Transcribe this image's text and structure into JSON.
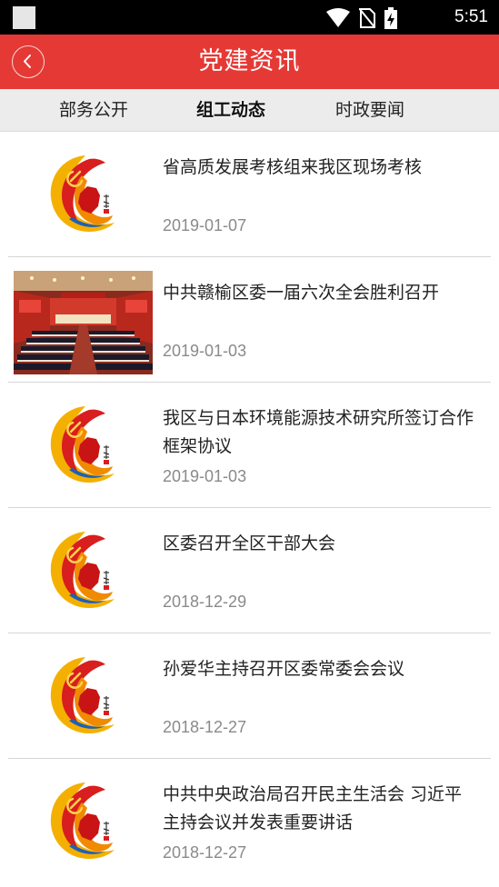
{
  "status_bar": {
    "time": "5:51"
  },
  "header": {
    "title": "党建资讯",
    "back_icon": "chevron-left-icon"
  },
  "tabs": [
    {
      "label": "部务公开",
      "active": false
    },
    {
      "label": "组工动态",
      "active": true
    },
    {
      "label": "时政要闻",
      "active": false
    }
  ],
  "news": [
    {
      "title": "省高质发展考核组来我区现场考核",
      "date": "2019-01-07",
      "thumb": "party-logo"
    },
    {
      "title": "中共赣榆区委一届六次全会胜利召开",
      "date": "2019-01-03",
      "thumb": "conference-photo"
    },
    {
      "title": "我区与日本环境能源技术研究所签订合作框架协议",
      "date": "2019-01-03",
      "thumb": "party-logo"
    },
    {
      "title": "区委召开全区干部大会",
      "date": "2018-12-29",
      "thumb": "party-logo"
    },
    {
      "title": "孙爱华主持召开区委常委会会议",
      "date": "2018-12-27",
      "thumb": "party-logo"
    },
    {
      "title": "中共中央政治局召开民主生活会 习近平主持会议并发表重要讲话",
      "date": "2018-12-27",
      "thumb": "party-logo"
    }
  ],
  "colors": {
    "header": "#e53935",
    "tab_bar": "#ececec",
    "date": "#8a8a8a"
  }
}
